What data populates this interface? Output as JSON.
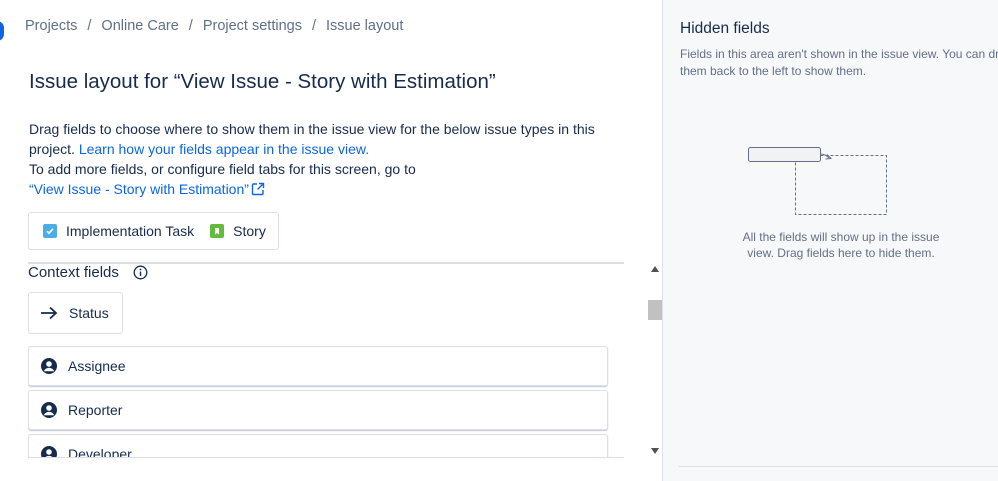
{
  "breadcrumb": {
    "items": [
      "Projects",
      "Online Care",
      "Project settings",
      "Issue layout"
    ],
    "separator": "/"
  },
  "page": {
    "title": "Issue layout for “View Issue - Story with Estimation”",
    "desc_line1": "Drag fields to choose where to show them in the issue view for the below issue types in this project.",
    "learn_link": "Learn how your fields appear in the issue view.",
    "desc_line2": "To add more fields, or configure field tabs for this screen, go to",
    "screen_link": "“View Issue - Story with Estimation”"
  },
  "issue_types": [
    {
      "label": "Implementation Task",
      "icon": "task-checkbox-icon",
      "color": "#4bade8"
    },
    {
      "label": "Story",
      "icon": "story-bookmark-icon",
      "color": "#63ba3c"
    }
  ],
  "context_fields": {
    "heading": "Context fields",
    "status_label": "Status",
    "fields": [
      "Assignee",
      "Reporter",
      "Developer"
    ]
  },
  "hidden_panel": {
    "title": "Hidden fields",
    "description": "Fields in this area aren't shown in the issue view. You can drag them back to the left to show them.",
    "empty_text": "All the fields will show up in the issue view. Drag fields here to hide them."
  },
  "colors": {
    "link": "#0c66e4",
    "text": "#172b4d",
    "subtle": "#626f86",
    "panel_bg": "#f7f8f9"
  }
}
